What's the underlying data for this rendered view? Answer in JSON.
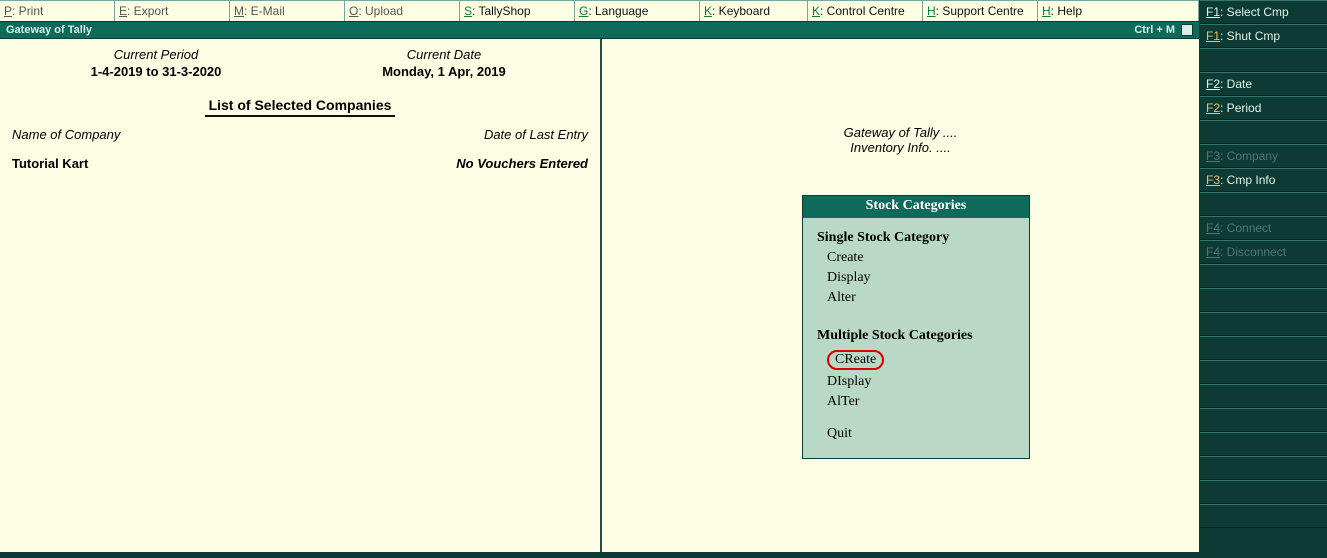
{
  "topbar": [
    {
      "hot": "P",
      "label": ": Print",
      "enabled": false
    },
    {
      "hot": "E",
      "label": ": Export",
      "enabled": false
    },
    {
      "hot": "M",
      "label": ": E-Mail",
      "enabled": false
    },
    {
      "hot": "O",
      "label": ": Upload",
      "enabled": false
    },
    {
      "hot": "S",
      "label": ": TallyShop",
      "enabled": true
    },
    {
      "hot": "G",
      "label": ": Language",
      "enabled": true
    },
    {
      "hot": "K",
      "label": ": Keyboard",
      "enabled": true
    },
    {
      "hot": "K",
      "label": ": Control Centre",
      "enabled": true
    },
    {
      "hot": "H",
      "label": ": Support Centre",
      "enabled": true
    },
    {
      "hot": "H",
      "label": ": Help",
      "enabled": true
    }
  ],
  "titlebar": {
    "left": "Gateway of Tally",
    "right": "Ctrl + M"
  },
  "left": {
    "period_label": "Current Period",
    "period_value": "1-4-2019 to 31-3-2020",
    "date_label": "Current Date",
    "date_value": "Monday, 1 Apr, 2019",
    "list_heading": "List of Selected Companies",
    "colA": "Name of Company",
    "colB": "Date of Last Entry",
    "company": "Tutorial Kart",
    "novouch": "No Vouchers Entered"
  },
  "crumbs": {
    "line1": "Gateway of Tally ....",
    "line2": "Inventory Info. ...."
  },
  "menu": {
    "title": "Stock Categories",
    "sec1": "Single Stock Category",
    "s1": [
      "Create",
      "Display",
      "Alter"
    ],
    "sec2": "Multiple Stock Categories",
    "s2": [
      "CReate",
      "DIsplay",
      "AlTer"
    ],
    "quit": "Quit"
  },
  "sidebar": [
    {
      "fk": "F1",
      "label": ": Select Cmp",
      "state": "on"
    },
    {
      "fk": "F1",
      "label": ": Shut Cmp",
      "state": "alt"
    },
    {
      "fk": "",
      "label": "",
      "state": "empty"
    },
    {
      "fk": "F2",
      "label": ": Date",
      "state": "on"
    },
    {
      "fk": "F2",
      "label": ": Period",
      "state": "alt"
    },
    {
      "fk": "",
      "label": "",
      "state": "empty"
    },
    {
      "fk": "F3",
      "label": ": Company",
      "state": "disabled"
    },
    {
      "fk": "F3",
      "label": ": Cmp Info",
      "state": "alt"
    },
    {
      "fk": "",
      "label": "",
      "state": "empty"
    },
    {
      "fk": "F4",
      "label": ": Connect",
      "state": "disabled"
    },
    {
      "fk": "F4",
      "label": ": Disconnect",
      "state": "disabled"
    },
    {
      "fk": "",
      "label": "",
      "state": "empty"
    },
    {
      "fk": "",
      "label": "",
      "state": "empty"
    },
    {
      "fk": "",
      "label": "",
      "state": "empty"
    },
    {
      "fk": "",
      "label": "",
      "state": "empty"
    },
    {
      "fk": "",
      "label": "",
      "state": "empty"
    },
    {
      "fk": "",
      "label": "",
      "state": "empty"
    },
    {
      "fk": "",
      "label": "",
      "state": "empty"
    },
    {
      "fk": "",
      "label": "",
      "state": "empty"
    },
    {
      "fk": "",
      "label": "",
      "state": "empty"
    },
    {
      "fk": "",
      "label": "",
      "state": "empty"
    },
    {
      "fk": "",
      "label": "",
      "state": "empty"
    }
  ]
}
